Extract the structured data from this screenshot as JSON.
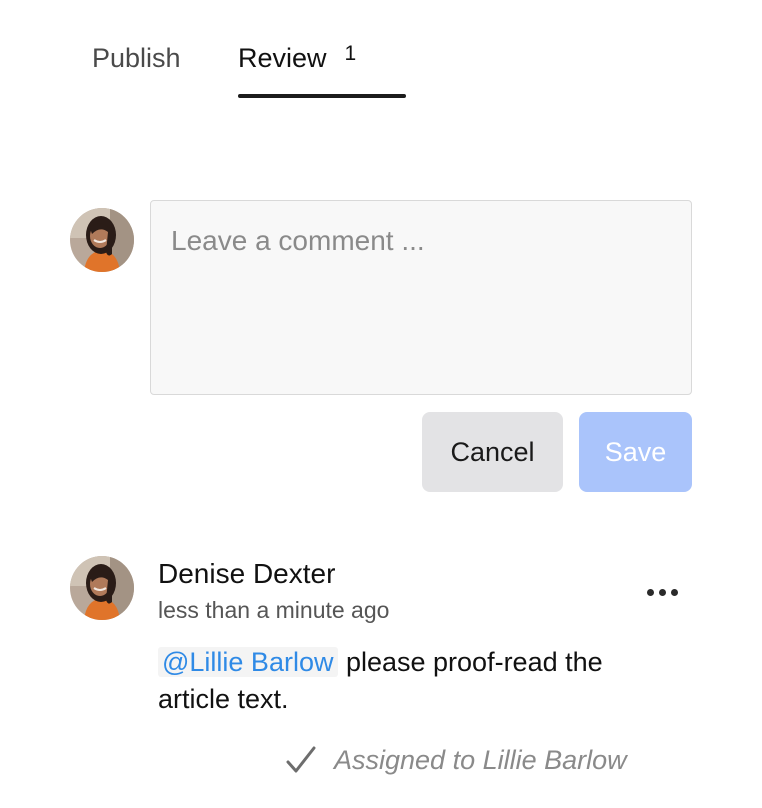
{
  "tabs": {
    "publish": {
      "label": "Publish"
    },
    "review": {
      "label": "Review",
      "count": "1",
      "active": true
    }
  },
  "composer": {
    "placeholder": "Leave a comment ...",
    "value": "",
    "cancel_label": "Cancel",
    "save_label": "Save"
  },
  "comment": {
    "author": "Denise Dexter",
    "time": "less than a minute ago",
    "mention": "@Lillie Barlow",
    "text": " please proof-read the article text.",
    "assigned": "Assigned to Lillie Barlow",
    "more_icon": "more-horizontal-icon",
    "check_icon": "checkmark-icon"
  },
  "colors": {
    "accent_link": "#2f8ae6",
    "save_disabled": "#aac4fb",
    "cancel_bg": "#e3e3e5",
    "tab_underline": "#1c1c1c"
  }
}
